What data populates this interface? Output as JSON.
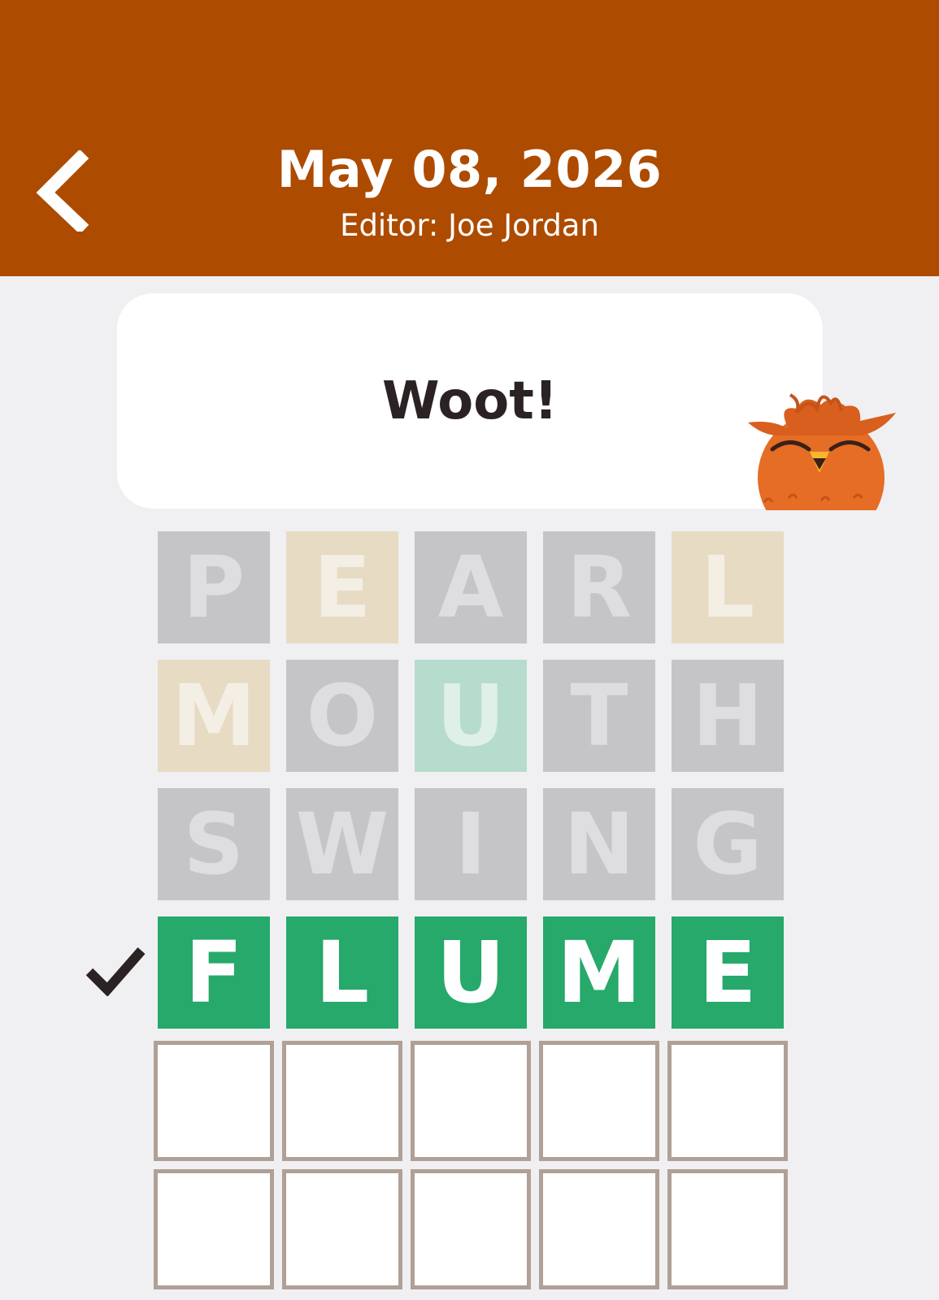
{
  "header": {
    "date": "May 08, 2026",
    "editor": "Editor: Joe Jordan",
    "back_icon": "chevron-left-icon",
    "color": "#ad4b00"
  },
  "bubble": {
    "message": "Woot!"
  },
  "mascot": {
    "icon": "owl-mascot-icon"
  },
  "colors": {
    "absent": "#c5c5c7",
    "present": "#e7dbc4",
    "correct": "#26a96a",
    "empty_border": "#b0a095"
  },
  "board": {
    "rows": [
      {
        "letters": [
          "P",
          "E",
          "A",
          "R",
          "L"
        ],
        "states": [
          "absent",
          "present",
          "absent",
          "absent",
          "present"
        ]
      },
      {
        "letters": [
          "M",
          "O",
          "U",
          "T",
          "H"
        ],
        "states": [
          "present",
          "absent",
          "correct-dim",
          "absent",
          "absent"
        ]
      },
      {
        "letters": [
          "S",
          "W",
          "I",
          "N",
          "G"
        ],
        "states": [
          "absent",
          "absent",
          "absent",
          "absent",
          "absent"
        ]
      },
      {
        "letters": [
          "F",
          "L",
          "U",
          "M",
          "E"
        ],
        "states": [
          "correct",
          "correct",
          "correct",
          "correct",
          "correct"
        ],
        "solved": true
      },
      {
        "letters": [
          "",
          "",
          "",
          "",
          ""
        ],
        "states": [
          "empty",
          "empty",
          "empty",
          "empty",
          "empty"
        ]
      },
      {
        "letters": [
          "",
          "",
          "",
          "",
          ""
        ],
        "states": [
          "empty",
          "empty",
          "empty",
          "empty",
          "empty"
        ]
      }
    ]
  }
}
